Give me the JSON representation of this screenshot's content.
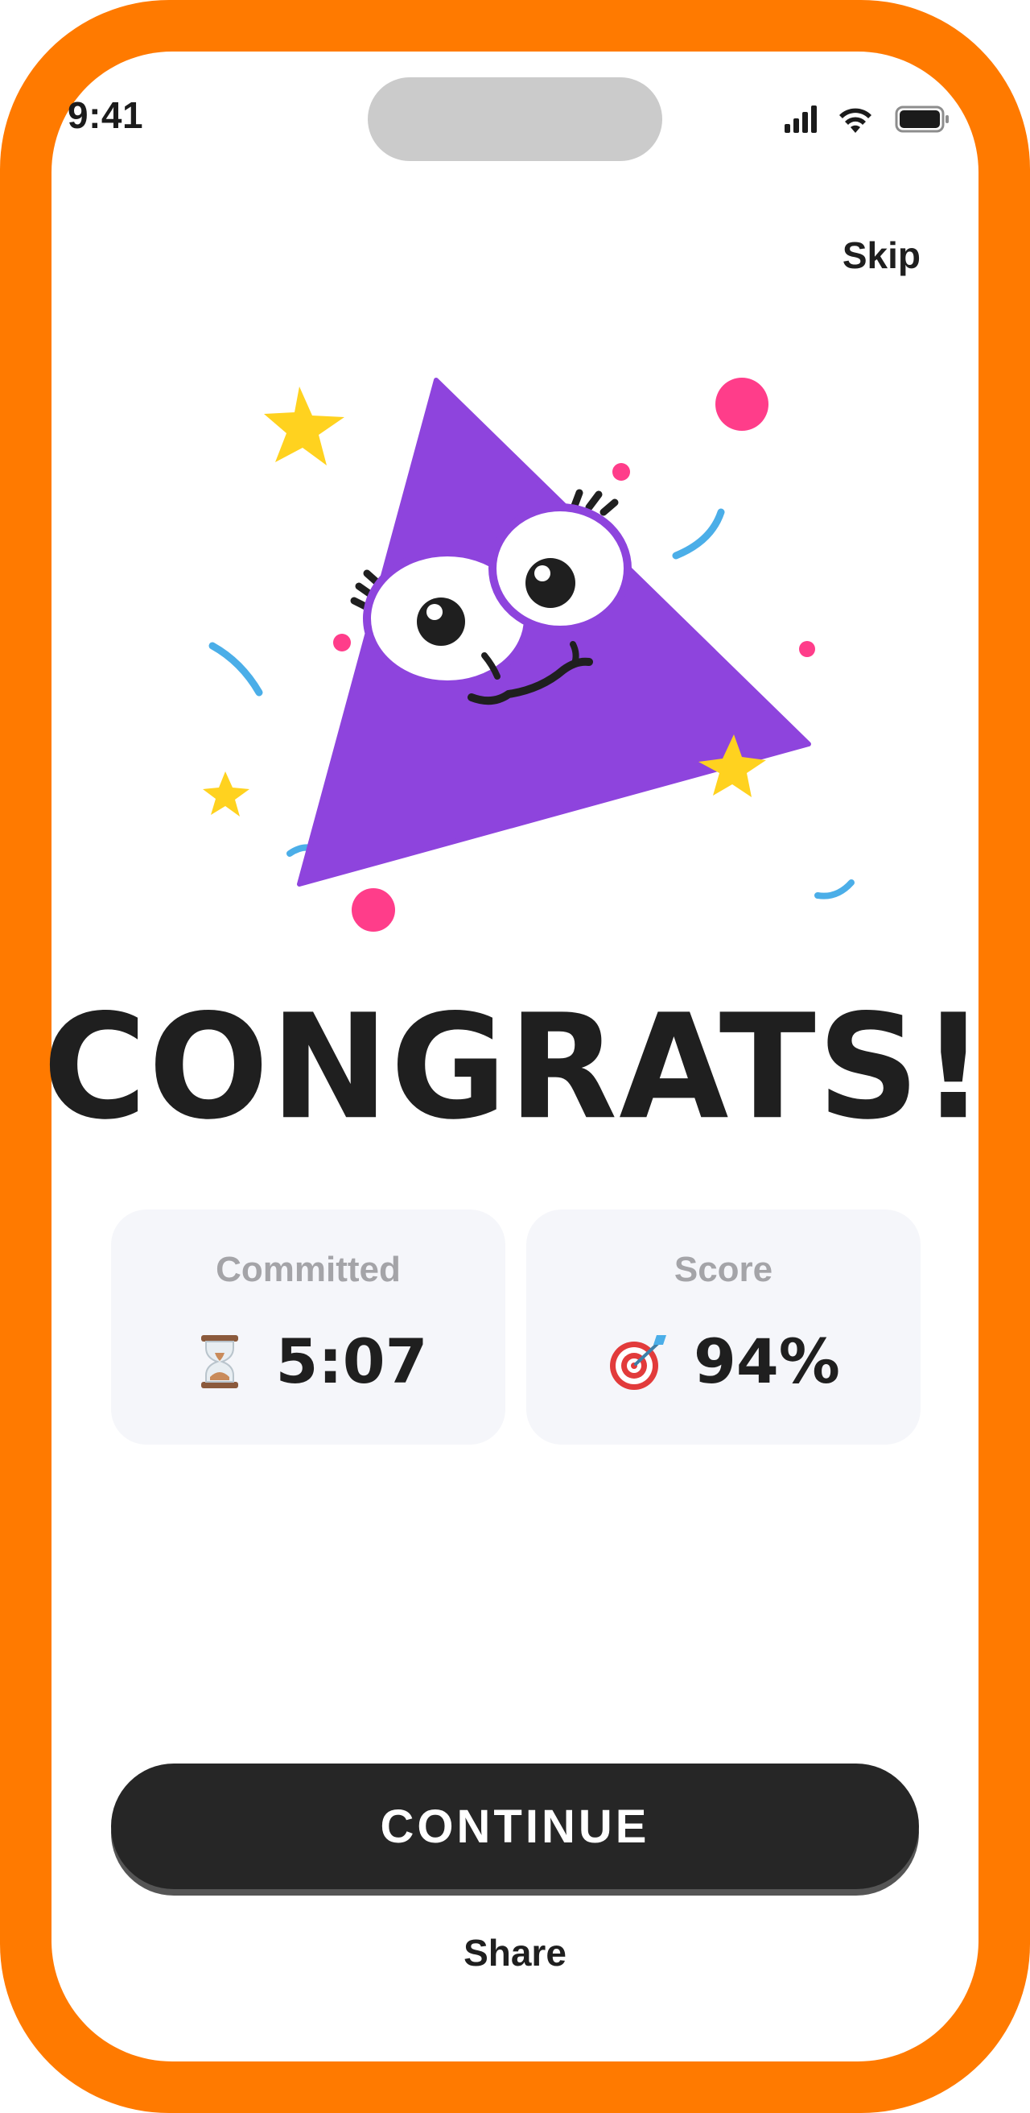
{
  "status_bar": {
    "time": "9:41",
    "icons": [
      "cellular-signal-icon",
      "wifi-icon",
      "battery-icon"
    ]
  },
  "header": {
    "skip_label": "Skip"
  },
  "illustration": {
    "name": "happy-triangle-mascot",
    "colors": {
      "triangle": "#8E44DD",
      "confetti_pink": "#FF3D8A",
      "confetti_yellow": "#FFD21F",
      "confetti_blue": "#4BAEE8"
    }
  },
  "title": "CONGRATS!",
  "stats": [
    {
      "label": "Committed",
      "icon": "hourglass-icon",
      "value": "5:07"
    },
    {
      "label": "Score",
      "icon": "target-icon",
      "value": "94%"
    }
  ],
  "actions": {
    "continue_label": "CONTINUE",
    "share_label": "Share"
  },
  "colors": {
    "frame": "#FF7A00",
    "button": "#262626",
    "card_bg": "#F5F6FA",
    "label_grey": "#A4A4A8"
  }
}
